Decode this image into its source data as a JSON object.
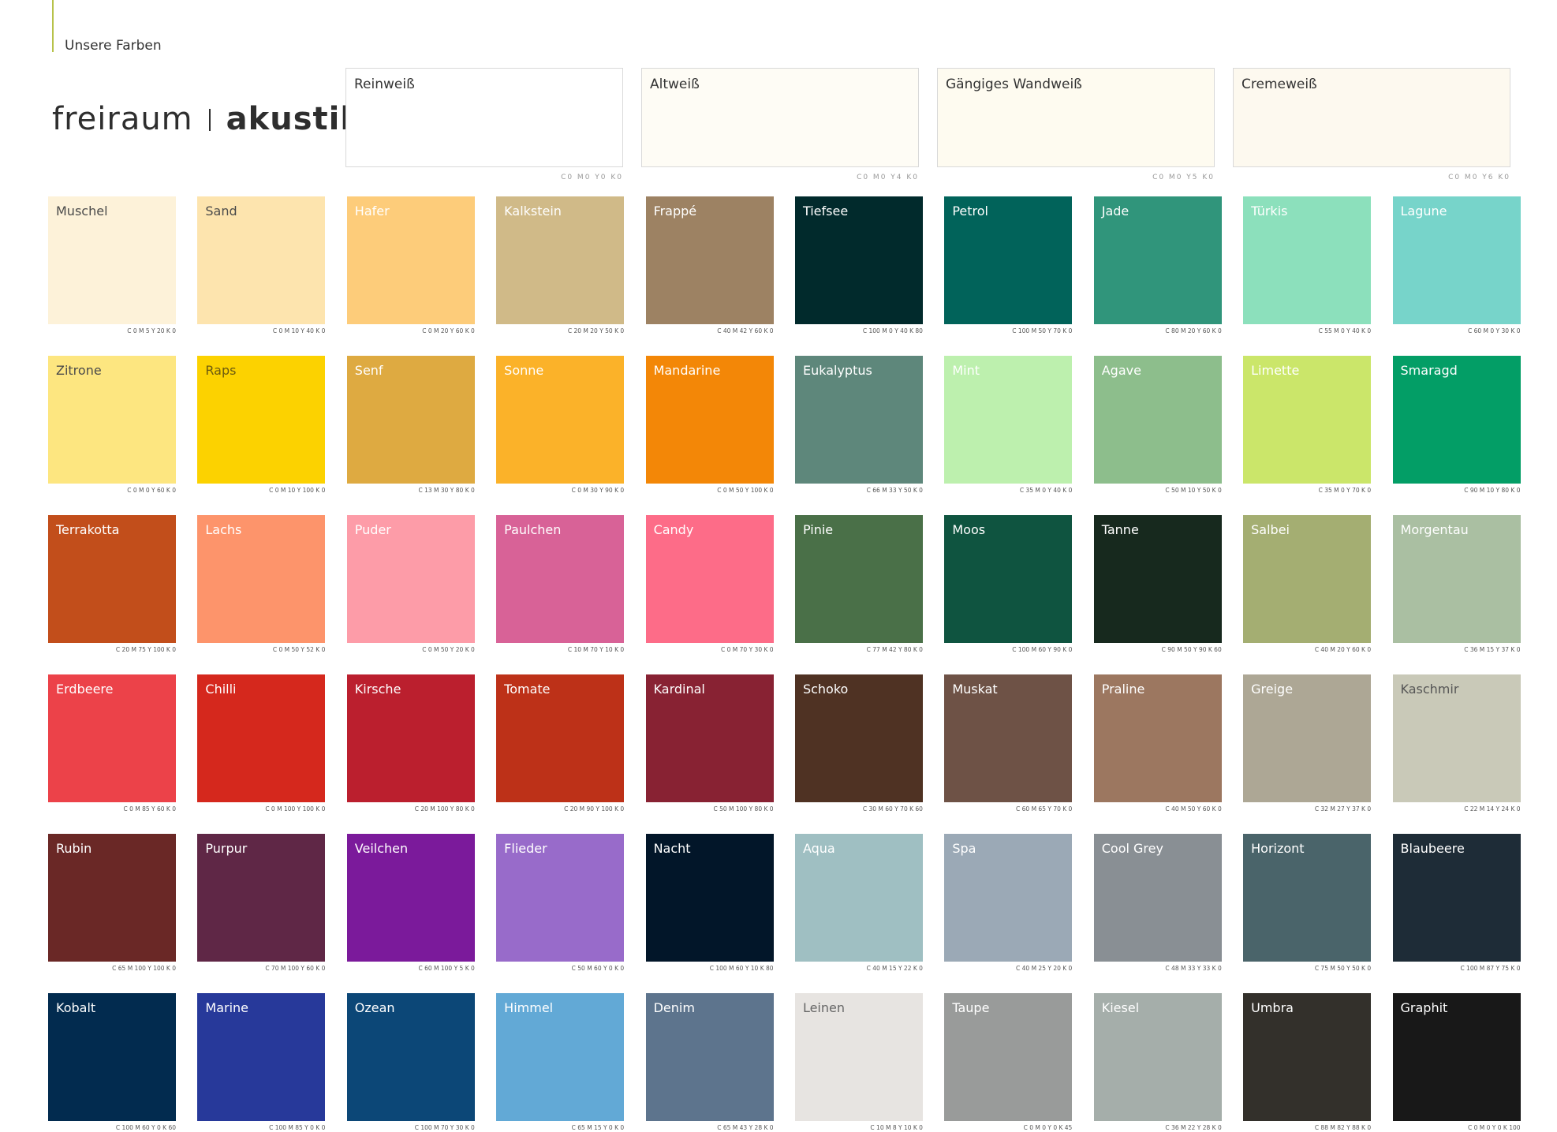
{
  "page": {
    "header": "Unsere Farben"
  },
  "logo": {
    "light": "freiraum",
    "bold": "akustik"
  },
  "whites": [
    {
      "name": "Reinweiß",
      "cmyk": "C0 M0 Y0 K0",
      "color": "#ffffff"
    },
    {
      "name": "Altweiß",
      "cmyk": "C0 M0 Y4 K0",
      "color": "#fefcf5"
    },
    {
      "name": "Gängiges Wandweiß",
      "cmyk": "C0 M0 Y5 K0",
      "color": "#fefbf0"
    },
    {
      "name": "Cremeweiß",
      "cmyk": "C0 M0 Y6 K0",
      "color": "#fdf9ef"
    }
  ],
  "colors": [
    {
      "name": "Muschel",
      "cmyk": "C 0 M 5 Y 20 K 0",
      "color": "#fdf2d9",
      "text_color": "#4a4a4a"
    },
    {
      "name": "Sand",
      "cmyk": "C 0 M 10 Y 40 K 0",
      "color": "#fde4ae",
      "text_color": "#4a4a4a"
    },
    {
      "name": "Hafer",
      "cmyk": "C 0 M 20 Y 60 K 0",
      "color": "#fdcc7a",
      "text_color": "#ffffff"
    },
    {
      "name": "Kalkstein",
      "cmyk": "C 20 M 20 Y 50 K 0",
      "color": "#d0ba88",
      "text_color": "#ffffff"
    },
    {
      "name": "Frappé",
      "cmyk": "C 40 M 42 Y 60 K 0",
      "color": "#9d8263",
      "text_color": "#ffffff"
    },
    {
      "name": "Tiefsee",
      "cmyk": "C 100 M 0 Y 40 K 80",
      "color": "#012a2c",
      "text_color": "#ffffff"
    },
    {
      "name": "Petrol",
      "cmyk": "C 100 M 50 Y 70 K 0",
      "color": "#01635a",
      "text_color": "#ffffff"
    },
    {
      "name": "Jade",
      "cmyk": "C 80 M 20 Y 60 K 0",
      "color": "#30957b",
      "text_color": "#ffffff"
    },
    {
      "name": "Türkis",
      "cmyk": "C 55 M 0 Y 40 K 0",
      "color": "#8ce0bc",
      "text_color": "#ffffff"
    },
    {
      "name": "Lagune",
      "cmyk": "C 60 M 0 Y 30 K 0",
      "color": "#77d4ca",
      "text_color": "#ffffff"
    },
    {
      "name": "Zitrone",
      "cmyk": "C 0 M 0 Y 60 K 0",
      "color": "#fde680",
      "text_color": "#4a4a4a"
    },
    {
      "name": "Raps",
      "cmyk": "C 0 M 10 Y 100 K 0",
      "color": "#fcd200",
      "text_color": "#6b5a10"
    },
    {
      "name": "Senf",
      "cmyk": "C 13 M 30 Y 80 K 0",
      "color": "#deaa41",
      "text_color": "#ffffff"
    },
    {
      "name": "Sonne",
      "cmyk": "C 0 M 30 Y 90 K 0",
      "color": "#fbb229",
      "text_color": "#ffffff"
    },
    {
      "name": "Mandarine",
      "cmyk": "C 0 M 50 Y 100 K 0",
      "color": "#f38707",
      "text_color": "#ffffff"
    },
    {
      "name": "Eukalyptus",
      "cmyk": "C 66 M 33 Y 50 K 0",
      "color": "#5e877b",
      "text_color": "#ffffff"
    },
    {
      "name": "Mint",
      "cmyk": "C 35 M 0 Y 40 K 0",
      "color": "#bdf0ae",
      "text_color": "#ffffff"
    },
    {
      "name": "Agave",
      "cmyk": "C 50 M 10 Y 50 K 0",
      "color": "#8dbe8c",
      "text_color": "#ffffff"
    },
    {
      "name": "Limette",
      "cmyk": "C 35 M 0 Y 70 K 0",
      "color": "#cbe66a",
      "text_color": "#ffffff"
    },
    {
      "name": "Smaragd",
      "cmyk": "C 90 M 10 Y 80 K 0",
      "color": "#039e66",
      "text_color": "#ffffff"
    },
    {
      "name": "Terrakotta",
      "cmyk": "C 20 M 75 Y 100 K 0",
      "color": "#c24e1b",
      "text_color": "#ffffff"
    },
    {
      "name": "Lachs",
      "cmyk": "C 0 M 50 Y 52 K 0",
      "color": "#fd946b",
      "text_color": "#ffffff"
    },
    {
      "name": "Puder",
      "cmyk": "C 0 M 50 Y 20 K 0",
      "color": "#fd9ca8",
      "text_color": "#ffffff"
    },
    {
      "name": "Paulchen",
      "cmyk": "C 10 M 70 Y 10 K 0",
      "color": "#d86297",
      "text_color": "#ffffff"
    },
    {
      "name": "Candy",
      "cmyk": "C 0 M 70 Y 30 K 0",
      "color": "#fd6c88",
      "text_color": "#ffffff"
    },
    {
      "name": "Pinie",
      "cmyk": "C 77 M 42 Y 80 K 0",
      "color": "#4a7048",
      "text_color": "#ffffff"
    },
    {
      "name": "Moos",
      "cmyk": "C 100 M 60 Y 90 K 0",
      "color": "#0f5440",
      "text_color": "#ffffff"
    },
    {
      "name": "Tanne",
      "cmyk": "C 90 M 50 Y 90 K 60",
      "color": "#17291e",
      "text_color": "#ffffff"
    },
    {
      "name": "Salbei",
      "cmyk": "C 40 M 20 Y 60 K 0",
      "color": "#a4ae72",
      "text_color": "#ffffff"
    },
    {
      "name": "Morgentau",
      "cmyk": "C 36 M 15 Y 37 K 0",
      "color": "#aabfa2",
      "text_color": "#ffffff"
    },
    {
      "name": "Erdbeere",
      "cmyk": "C 0 M 85 Y 60 K 0",
      "color": "#ec4249",
      "text_color": "#ffffff"
    },
    {
      "name": "Chilli",
      "cmyk": "C 0 M 100 Y 100 K 0",
      "color": "#d5281d",
      "text_color": "#ffffff"
    },
    {
      "name": "Kirsche",
      "cmyk": "C 20 M 100 Y 80 K 0",
      "color": "#bb1f2e",
      "text_color": "#ffffff"
    },
    {
      "name": "Tomate",
      "cmyk": "C 20 M 90 Y 100 K 0",
      "color": "#bd3118",
      "text_color": "#ffffff"
    },
    {
      "name": "Kardinal",
      "cmyk": "C 50 M 100 Y 80 K 0",
      "color": "#882233",
      "text_color": "#ffffff"
    },
    {
      "name": "Schoko",
      "cmyk": "C 30 M 60 Y 70 K 60",
      "color": "#4f3223",
      "text_color": "#ffffff"
    },
    {
      "name": "Muskat",
      "cmyk": "C 60 M 65 Y 70 K 0",
      "color": "#6e5246",
      "text_color": "#ffffff"
    },
    {
      "name": "Praline",
      "cmyk": "C 40 M 50 Y 60 K 0",
      "color": "#9c7760",
      "text_color": "#ffffff"
    },
    {
      "name": "Greige",
      "cmyk": "C 32 M 27 Y 37 K 0",
      "color": "#ada795",
      "text_color": "#ffffff"
    },
    {
      "name": "Kaschmir",
      "cmyk": "C 22 M 14 Y 24 K 0",
      "color": "#c9c9b8",
      "text_color": "#555555"
    },
    {
      "name": "Rubin",
      "cmyk": "C 65 M 100 Y 100 K 0",
      "color": "#6a2826",
      "text_color": "#ffffff"
    },
    {
      "name": "Purpur",
      "cmyk": "C 70 M 100 Y 60 K 0",
      "color": "#5f2746",
      "text_color": "#ffffff"
    },
    {
      "name": "Veilchen",
      "cmyk": "C 60 M 100 Y 5 K 0",
      "color": "#7b1a9b",
      "text_color": "#ffffff"
    },
    {
      "name": "Flieder",
      "cmyk": "C 50 M 60 Y 0 K 0",
      "color": "#986bca",
      "text_color": "#ffffff"
    },
    {
      "name": "Nacht",
      "cmyk": "C 100 M 60 Y 10 K 80",
      "color": "#021629",
      "text_color": "#ffffff"
    },
    {
      "name": "Aqua",
      "cmyk": "C 40 M 15 Y 22 K 0",
      "color": "#9fbfc2",
      "text_color": "#ffffff"
    },
    {
      "name": "Spa",
      "cmyk": "C 40 M 25 Y 20 K 0",
      "color": "#9ba9b6",
      "text_color": "#ffffff"
    },
    {
      "name": "Cool Grey",
      "cmyk": "C 48 M 33 Y 33 K 0",
      "color": "#898f94",
      "text_color": "#ffffff"
    },
    {
      "name": "Horizont",
      "cmyk": "C 75 M 50 Y 50 K 0",
      "color": "#4a646a",
      "text_color": "#ffffff"
    },
    {
      "name": "Blaubeere",
      "cmyk": "C 100 M 87 Y 75 K 0",
      "color": "#1e2c37",
      "text_color": "#ffffff"
    },
    {
      "name": "Kobalt",
      "cmyk": "C 100 M 60 Y 0 K 60",
      "color": "#022b4f",
      "text_color": "#ffffff"
    },
    {
      "name": "Marine",
      "cmyk": "C 100 M 85 Y 0 K 0",
      "color": "#27399a",
      "text_color": "#ffffff"
    },
    {
      "name": "Ozean",
      "cmyk": "C 100 M 70 Y 30 K 0",
      "color": "#0c4777",
      "text_color": "#ffffff"
    },
    {
      "name": "Himmel",
      "cmyk": "C 65 M 15 Y 0 K 0",
      "color": "#62a9d6",
      "text_color": "#ffffff"
    },
    {
      "name": "Denim",
      "cmyk": "C 65 M 43 Y 28 K 0",
      "color": "#5d748d",
      "text_color": "#ffffff"
    },
    {
      "name": "Leinen",
      "cmyk": "C 10 M 8 Y 10 K 0",
      "color": "#e7e4e1",
      "text_color": "#666666"
    },
    {
      "name": "Taupe",
      "cmyk": "C 0 M 0 Y 0 K 45",
      "color": "#999b9a",
      "text_color": "#ffffff"
    },
    {
      "name": "Kiesel",
      "cmyk": "C 36 M 22 Y 28 K 0",
      "color": "#a5aeaa",
      "text_color": "#ffffff"
    },
    {
      "name": "Umbra",
      "cmyk": "C 88 M 82 Y 88 K 0",
      "color": "#33302b",
      "text_color": "#ffffff"
    },
    {
      "name": "Graphit",
      "cmyk": "C 0 M 0 Y 0 K 100",
      "color": "#181818",
      "text_color": "#ffffff"
    }
  ]
}
